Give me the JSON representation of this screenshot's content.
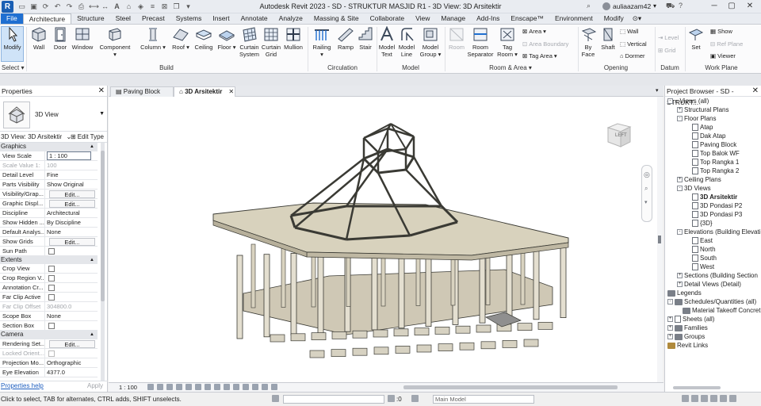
{
  "window": {
    "title": "Autodesk Revit 2023 - SD - STRUKTUR MASJID R1 - 3D View: 3D Arsitektir",
    "user": "auliaazam42"
  },
  "menu": {
    "file": "File",
    "tabs": [
      "Architecture",
      "Structure",
      "Steel",
      "Precast",
      "Systems",
      "Insert",
      "Annotate",
      "Analyze",
      "Massing & Site",
      "Collaborate",
      "View",
      "Manage",
      "Add-Ins",
      "Enscape™",
      "Environment",
      "Modify"
    ],
    "active": "Architecture"
  },
  "ribbon": {
    "select": {
      "modify": "Modify",
      "panel": "Select"
    },
    "build": {
      "panel": "Build",
      "wall": "Wall",
      "door": "Door",
      "window": "Window",
      "component": "Component",
      "column": "Column",
      "roof": "Roof",
      "ceiling": "Ceiling",
      "floor": "Floor",
      "curtain_system_1": "Curtain",
      "curtain_system_2": "System",
      "curtain_grid_1": "Curtain",
      "curtain_grid_2": "Grid",
      "mullion": "Mullion"
    },
    "circulation": {
      "panel": "Circulation",
      "railing": "Railing",
      "ramp": "Ramp",
      "stair": "Stair"
    },
    "model": {
      "panel": "Model",
      "model_text_1": "Model",
      "model_text_2": "Text",
      "model_line_1": "Model",
      "model_line_2": "Line",
      "model_group_1": "Model",
      "model_group_2": "Group"
    },
    "room_area": {
      "panel": "Room & Area",
      "room": "Room",
      "room_sep_1": "Room",
      "room_sep_2": "Separator",
      "tag_room_1": "Tag",
      "tag_room_2": "Room",
      "area": "Area",
      "area_boundary": "Area Boundary",
      "tag_area": "Tag Area"
    },
    "opening": {
      "panel": "Opening",
      "by_face_1": "By",
      "by_face_2": "Face",
      "shaft": "Shaft",
      "wall": "Wall",
      "vertical": "Vertical",
      "dormer": "Dormer"
    },
    "datum": {
      "panel": "Datum",
      "level": "Level",
      "grid": "Grid"
    },
    "work_plane": {
      "panel": "Work Plane",
      "set": "Set",
      "show": "Show",
      "ref_plane": "Ref Plane",
      "viewer": "Viewer"
    }
  },
  "properties": {
    "header": "Properties",
    "type_name": "3D View",
    "view_selector": "3D View: 3D Arsitektir",
    "edit_type": "Edit Type",
    "groups": [
      {
        "name": "Graphics",
        "rows": [
          [
            "View Scale",
            "1 : 100"
          ],
          [
            "Scale Value   1:",
            "100"
          ],
          [
            "Detail Level",
            "Fine"
          ],
          [
            "Parts Visibility",
            "Show Original"
          ],
          [
            "Visibility/Grap...",
            "Edit..."
          ],
          [
            "Graphic Displ...",
            "Edit..."
          ],
          [
            "Discipline",
            "Architectural"
          ],
          [
            "Show Hidden ...",
            "By Discipline"
          ],
          [
            "Default Analys...",
            "None"
          ],
          [
            "Show Grids",
            "Edit..."
          ],
          [
            "Sun Path",
            ""
          ]
        ]
      },
      {
        "name": "Extents",
        "rows": [
          [
            "Crop View",
            ""
          ],
          [
            "Crop Region V...",
            ""
          ],
          [
            "Annotation Cr...",
            ""
          ],
          [
            "Far Clip Active",
            ""
          ],
          [
            "Far Clip Offset",
            "304800.0"
          ],
          [
            "Scope Box",
            "None"
          ],
          [
            "Section Box",
            ""
          ]
        ]
      },
      {
        "name": "Camera",
        "rows": [
          [
            "Rendering Set...",
            "Edit..."
          ],
          [
            "Locked Orient...",
            ""
          ],
          [
            "Projection Mo...",
            "Orthographic"
          ],
          [
            "Eye Elevation",
            "4377.0"
          ]
        ]
      }
    ],
    "help": "Properties help",
    "apply": "Apply"
  },
  "view_tabs": [
    {
      "label": "Paving Block",
      "active": false
    },
    {
      "label": "3D Arsitektir",
      "active": true
    }
  ],
  "viewcube": {
    "face": "LEFT"
  },
  "view_status": {
    "scale": "1 : 100"
  },
  "browser": {
    "header": "Project Browser - SD - STRUKT...",
    "tree": [
      {
        "label": "Views (all)",
        "level": 0,
        "toggle": "-",
        "icon": "views"
      },
      {
        "label": "Structural Plans",
        "level": 1,
        "toggle": "+"
      },
      {
        "label": "Floor Plans",
        "level": 1,
        "toggle": "-"
      },
      {
        "label": "Atap",
        "level": 2,
        "icon": "page"
      },
      {
        "label": "Dak Atap",
        "level": 2,
        "icon": "page"
      },
      {
        "label": "Paving Block",
        "level": 2,
        "icon": "page"
      },
      {
        "label": "Top Balok WF",
        "level": 2,
        "icon": "page"
      },
      {
        "label": "Top Rangka 1",
        "level": 2,
        "icon": "page"
      },
      {
        "label": "Top Rangka 2",
        "level": 2,
        "icon": "page"
      },
      {
        "label": "Ceiling Plans",
        "level": 1,
        "toggle": "+"
      },
      {
        "label": "3D Views",
        "level": 1,
        "toggle": "-"
      },
      {
        "label": "3D Arsitektir",
        "level": 2,
        "icon": "page",
        "selected": true
      },
      {
        "label": "3D Pondasi P2",
        "level": 2,
        "icon": "page"
      },
      {
        "label": "3D Pondasi P3",
        "level": 2,
        "icon": "page"
      },
      {
        "label": "{3D}",
        "level": 2,
        "icon": "page"
      },
      {
        "label": "Elevations (Building Elevati",
        "level": 1,
        "toggle": "-"
      },
      {
        "label": "East",
        "level": 2,
        "icon": "page"
      },
      {
        "label": "North",
        "level": 2,
        "icon": "page"
      },
      {
        "label": "South",
        "level": 2,
        "icon": "page"
      },
      {
        "label": "West",
        "level": 2,
        "icon": "page"
      },
      {
        "label": "Sections (Building Section",
        "level": 1,
        "toggle": "+"
      },
      {
        "label": "Detail Views (Detail)",
        "level": 1,
        "toggle": "+"
      },
      {
        "label": "Legends",
        "level": 0,
        "icon": "grid"
      },
      {
        "label": "Schedules/Quantities (all)",
        "level": 0,
        "toggle": "-",
        "icon": "grid"
      },
      {
        "label": "Material Takeoff Concret",
        "level": 1,
        "icon": "grid"
      },
      {
        "label": "Sheets (all)",
        "level": 0,
        "toggle": "+",
        "icon": "page"
      },
      {
        "label": "Families",
        "level": 0,
        "toggle": "+",
        "icon": "grid"
      },
      {
        "label": "Groups",
        "level": 0,
        "toggle": "+",
        "icon": "grid"
      },
      {
        "label": "Revit Links",
        "level": 0,
        "icon": "link"
      }
    ]
  },
  "statusbar": {
    "hint": "Click to select, TAB for alternates, CTRL adds, SHIFT unselects.",
    "zero": ":0",
    "main_model": "Main Model"
  },
  "colors": {
    "accent": "#1f6fd1",
    "selection": "#cfe3f8",
    "model_fill": "#e4dfd0",
    "model_stroke": "#3a3a34"
  }
}
